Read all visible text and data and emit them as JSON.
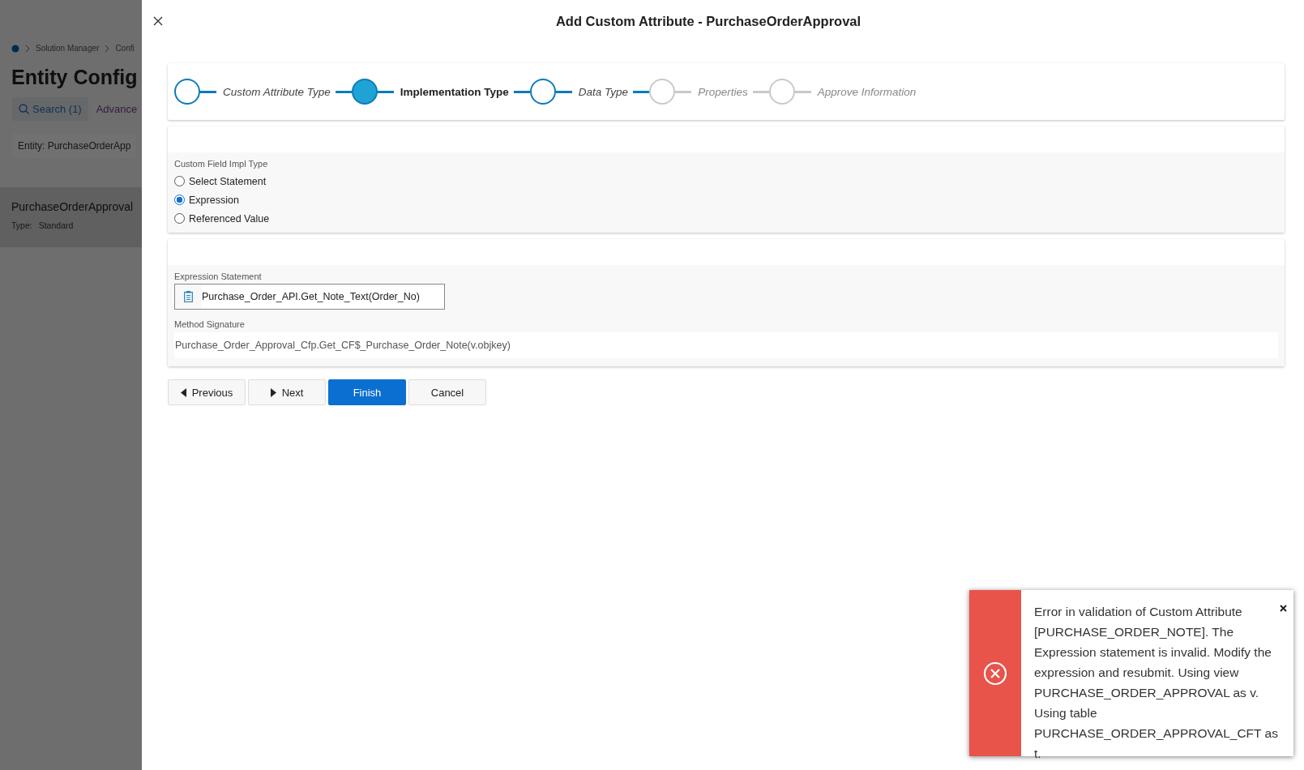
{
  "background_page": {
    "breadcrumb": [
      "Solution Manager",
      "Confi"
    ],
    "title": "Entity Config",
    "tabs": [
      {
        "label": "Search (1)",
        "selected": true
      },
      {
        "label": "Advance",
        "selected": false
      }
    ],
    "filter": "Entity: PurchaseOrderApp",
    "record": {
      "name": "PurchaseOrderApproval",
      "type_label": "Type:",
      "type_value": "Standard"
    }
  },
  "dialog": {
    "title": "Add Custom Attribute - PurchaseOrderApproval",
    "steps": [
      {
        "label": "Custom Attribute Type",
        "selected": false,
        "reached": true
      },
      {
        "label": "Implementation Type",
        "selected": true,
        "reached": true
      },
      {
        "label": "Data Type",
        "selected": false,
        "reached": true
      },
      {
        "label": "Properties",
        "selected": false,
        "reached": false
      },
      {
        "label": "Approve Information",
        "selected": false,
        "reached": false
      }
    ],
    "impl_type": {
      "label": "Custom Field Impl Type",
      "options": [
        {
          "label": "Select Statement",
          "selected": false
        },
        {
          "label": "Expression",
          "selected": true
        },
        {
          "label": "Referenced Value",
          "selected": false
        }
      ]
    },
    "expression": {
      "label": "Expression Statement",
      "value": "Purchase_Order_API.Get_Note_Text(Order_No)"
    },
    "signature": {
      "label": "Method Signature",
      "value": "Purchase_Order_Approval_Cfp.Get_CF$_Purchase_Order_Note(v.objkey)"
    },
    "buttons": [
      {
        "label": "Previous",
        "kind": "previous"
      },
      {
        "label": "Next",
        "kind": "next"
      },
      {
        "label": "Finish",
        "kind": "primary"
      },
      {
        "label": "Cancel",
        "kind": "plain"
      }
    ]
  },
  "toast": {
    "kind": "error",
    "message": "Error in validation of Custom Attribute [PURCHASE_ORDER_NOTE]. The Expression statement is invalid. Modify the expression and resubmit. Using view PURCHASE_ORDER_APPROVAL as v. Using table PURCHASE_ORDER_APPROVAL_CFT as t."
  }
}
